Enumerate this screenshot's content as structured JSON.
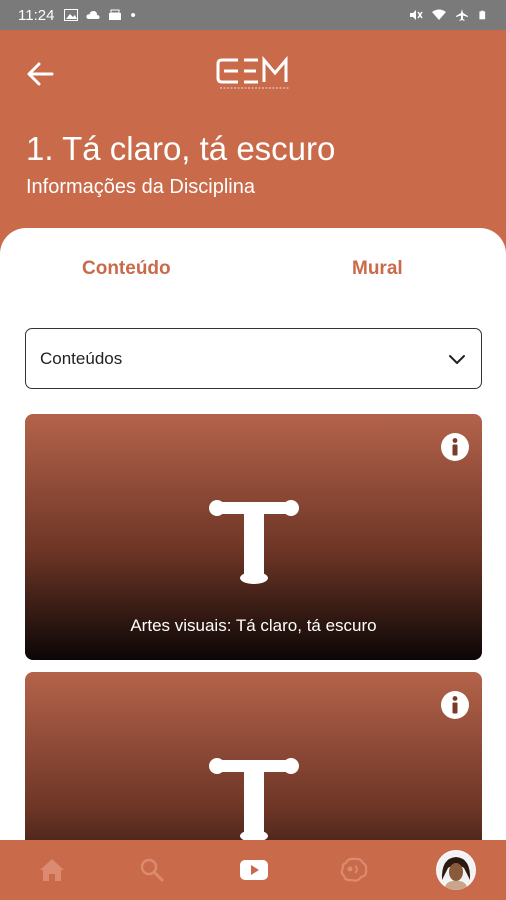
{
  "status_bar": {
    "time": "11:24",
    "dot": "•"
  },
  "header": {
    "title": "1. Tá claro, tá escuro",
    "subtitle": "Informações da Disciplina",
    "logo_text": "CEM"
  },
  "tabs": [
    {
      "label": "Conteúdo"
    },
    {
      "label": "Mural"
    }
  ],
  "select": {
    "value": "Conteúdos"
  },
  "cards": [
    {
      "glyph": "T",
      "title": "Artes visuais: Tá claro, tá escuro"
    },
    {
      "glyph": "T",
      "title": ""
    }
  ],
  "bottom_nav": [
    "home-icon",
    "search-icon",
    "video-icon",
    "brain-icon",
    "avatar"
  ],
  "colors": {
    "primary": "#c96a4b",
    "status_bar": "#7a7a7a",
    "card_dark": "#0b0605"
  }
}
